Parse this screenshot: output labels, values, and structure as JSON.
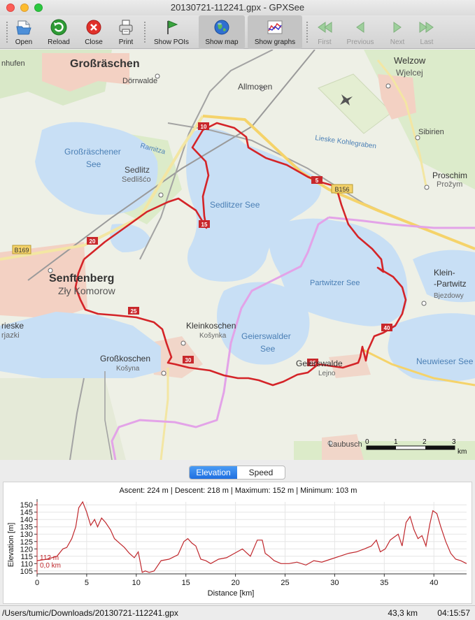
{
  "window": {
    "title": "20130721-112241.gpx - GPXSee"
  },
  "toolbar": {
    "open": "Open",
    "reload": "Reload",
    "close": "Close",
    "print": "Print",
    "show_pois": "Show POIs",
    "show_map": "Show map",
    "show_graphs": "Show graphs",
    "first": "First",
    "previous": "Previous",
    "next": "Next",
    "last": "Last"
  },
  "map": {
    "places": {
      "grossraeschen": "Großräschen",
      "doerrwalde": "Dörrwalde",
      "welzow": "Welzow",
      "wjelcej": "Wjelcej",
      "allmosen": "Allmosen",
      "nhufen": "nhufen",
      "grossraeschener_see_1": "Großräschener",
      "grossraeschener_see_2": "See",
      "ramitza": "Ramitza",
      "sedlitz": "Sedlitz",
      "sedlisco": "Sedlišćo",
      "sedlitzer_see": "Sedlitzer See",
      "lieske_kohlegraben": "Lieske Kohlegraben",
      "sibirien": "Sibirien",
      "proschim": "Proschim",
      "prozym": "Prožym",
      "senftenberg": "Senftenberg",
      "zly_komorow": "Zły Komorow",
      "partwitzer_see": "Partwitzer See",
      "klein_partwitz_1": "Klein-",
      "klein_partwitz_2": "-Partwitz",
      "bjezdowy": "Bjezdowy",
      "rieske": "rieske",
      "rjazki": "rjazki",
      "kleinkoschen": "Kleinkoschen",
      "kosynka": "Košynka",
      "geierswalder_see_1": "Geierswalder",
      "geierswalder_see_2": "See",
      "grosskoschen": "Großkoschen",
      "kosyna": "Košyna",
      "geierswalde": "Geierswalde",
      "lejno": "Lejno",
      "neuwieser_see": "Neuwieser See",
      "laubusch": "Laubusch",
      "b169": "B169",
      "b156": "B156"
    },
    "km_markers": [
      "5",
      "10",
      "15",
      "20",
      "25",
      "30",
      "35",
      "40"
    ],
    "scale": {
      "ticks": [
        "0",
        "1",
        "2",
        "3"
      ],
      "unit": "km"
    }
  },
  "tabs": {
    "elevation": "Elevation",
    "speed": "Speed"
  },
  "graph": {
    "info": "Ascent: 224 m | Descent: 218 m | Maximum: 152 m | Minimum: 103 m",
    "cursor_elevation": "112 m",
    "cursor_distance": "0,0 km",
    "line_color": "#c0282d"
  },
  "chart_data": {
    "type": "line",
    "xlabel": "Distance [km]",
    "ylabel": "Elevation [m]",
    "xlim": [
      0,
      43.3
    ],
    "ylim": [
      103,
      152
    ],
    "xticks": [
      "0",
      "5",
      "10",
      "15",
      "20",
      "25",
      "30",
      "35",
      "40"
    ],
    "yticks": [
      "105",
      "110",
      "115",
      "120",
      "125",
      "130",
      "135",
      "140",
      "145",
      "150"
    ],
    "x": [
      0,
      1,
      2,
      2.6,
      3,
      3.5,
      3.9,
      4.2,
      4.6,
      5.0,
      5.4,
      5.8,
      6.1,
      6.5,
      6.9,
      7.4,
      7.8,
      8.3,
      8.8,
      9.3,
      9.8,
      10.2,
      10.6,
      10.9,
      11.3,
      11.8,
      12.5,
      13.3,
      14.2,
      14.8,
      15.2,
      15.6,
      16.0,
      16.5,
      17.0,
      17.5,
      18.3,
      19.1,
      19.9,
      20.7,
      21.5,
      22.2,
      22.7,
      23.0,
      23.4,
      23.9,
      24.6,
      25.4,
      26.2,
      27.1,
      27.9,
      28.7,
      29.6,
      30.5,
      31.4,
      32.2,
      33.0,
      33.7,
      34.2,
      34.6,
      35.1,
      35.6,
      36.0,
      36.4,
      36.8,
      37.2,
      37.6,
      38.0,
      38.4,
      38.8,
      39.2,
      39.6,
      39.9,
      40.3,
      40.7,
      41.2,
      41.7,
      42.2,
      42.7,
      43.3
    ],
    "y": [
      112,
      113,
      115,
      120,
      121,
      127,
      135,
      148,
      152,
      145,
      136,
      140,
      135,
      141,
      138,
      133,
      127,
      124,
      121,
      117,
      114,
      118,
      104,
      105,
      104,
      105,
      112,
      113,
      116,
      125,
      127,
      124,
      122,
      113,
      112,
      110,
      113,
      114,
      117,
      120,
      115,
      126,
      126,
      117,
      115,
      112,
      110,
      110,
      111,
      109,
      112,
      111,
      113,
      115,
      117,
      118,
      120,
      122,
      126,
      118,
      120,
      126,
      128,
      130,
      122,
      138,
      142,
      133,
      127,
      129,
      122,
      137,
      146,
      144,
      135,
      125,
      117,
      113,
      112,
      110
    ]
  }
}
